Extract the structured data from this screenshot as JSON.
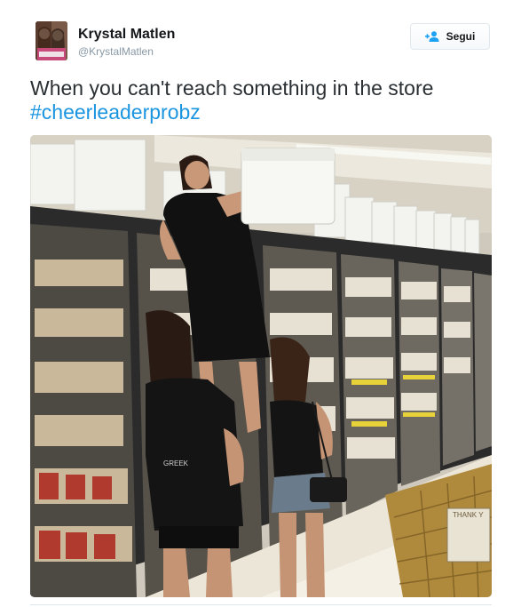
{
  "author": {
    "display_name": "Krystal Matlen",
    "handle": "@KrystalMatlen",
    "avatar_icon": "profile-photo"
  },
  "follow_button": {
    "label": "Segui",
    "icon": "follow-person-icon",
    "accent": "#1da1f2"
  },
  "tweet": {
    "text": "When you can't reach something in the store",
    "hashtag": "#cheerleaderprobz",
    "hashtag_color": "#1b95e0"
  },
  "media": {
    "type": "photo",
    "scene": "supermarket freezer aisle",
    "sign_text": "THANK Y"
  }
}
